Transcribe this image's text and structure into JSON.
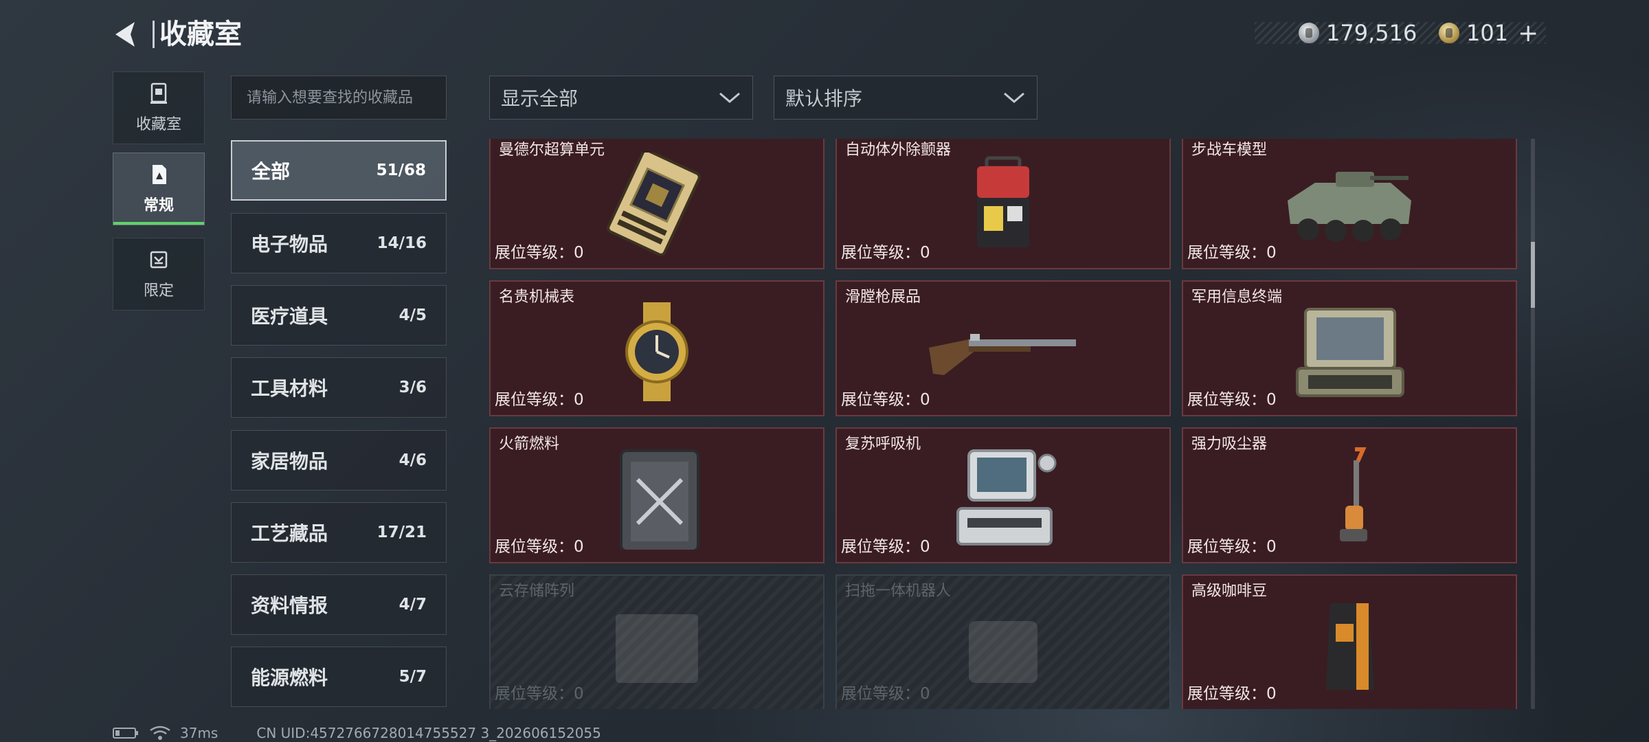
{
  "header": {
    "title": "收藏室"
  },
  "currency": {
    "silver": {
      "icon": "silver-coin-icon",
      "value": "179,516"
    },
    "gold": {
      "icon": "gold-coin-icon",
      "value": "101"
    },
    "plus": "+"
  },
  "sidebar": {
    "tabs": [
      {
        "label": "收藏室",
        "icon": "vault-icon"
      },
      {
        "label": "常规",
        "icon": "photo-frame-icon"
      },
      {
        "label": "限定",
        "icon": "limited-icon"
      }
    ],
    "active_index": 1
  },
  "search": {
    "placeholder": "请输入想要查找的收藏品"
  },
  "categories": [
    {
      "name": "全部",
      "count": "51/68"
    },
    {
      "name": "电子物品",
      "count": "14/16"
    },
    {
      "name": "医疗道具",
      "count": "4/5"
    },
    {
      "name": "工具材料",
      "count": "3/6"
    },
    {
      "name": "家居物品",
      "count": "4/6"
    },
    {
      "name": "工艺藏品",
      "count": "17/21"
    },
    {
      "name": "资料情报",
      "count": "4/7"
    },
    {
      "name": "能源燃料",
      "count": "5/7"
    }
  ],
  "filters": {
    "show": {
      "value": "显示全部"
    },
    "sort": {
      "value": "默认排序"
    }
  },
  "items": [
    {
      "name": "曼德尔超算单元",
      "level": "展位等级：0",
      "icon": "supercomputer-unit-icon",
      "locked": false
    },
    {
      "name": "自动体外除颤器",
      "level": "展位等级：0",
      "icon": "defibrillator-icon",
      "locked": false
    },
    {
      "name": "步战车模型",
      "level": "展位等级：0",
      "icon": "ifv-model-icon",
      "locked": false
    },
    {
      "name": "名贵机械表",
      "level": "展位等级：0",
      "icon": "luxury-watch-icon",
      "locked": false
    },
    {
      "name": "滑膛枪展品",
      "level": "展位等级：0",
      "icon": "musket-icon",
      "locked": false
    },
    {
      "name": "军用信息终端",
      "level": "展位等级：0",
      "icon": "military-terminal-icon",
      "locked": false
    },
    {
      "name": "火箭燃料",
      "level": "展位等级：0",
      "icon": "fuel-canister-icon",
      "locked": false
    },
    {
      "name": "复苏呼吸机",
      "level": "展位等级：0",
      "icon": "ventilator-icon",
      "locked": false
    },
    {
      "name": "强力吸尘器",
      "level": "展位等级：0",
      "icon": "vacuum-cleaner-icon",
      "locked": false
    },
    {
      "name": "云存储阵列",
      "level": "展位等级：0",
      "icon": "storage-array-icon",
      "locked": true
    },
    {
      "name": "扫拖一体机器人",
      "level": "展位等级：0",
      "icon": "robot-mop-icon",
      "locked": true
    },
    {
      "name": "高级咖啡豆",
      "level": "展位等级：0",
      "icon": "coffee-bag-icon",
      "locked": false
    }
  ],
  "status_bar": {
    "ping": "37ms",
    "uid": "CN UID:4572766728014755527 3_202606152055"
  },
  "colors": {
    "card_bg": "#3a1d22",
    "card_border": "#6a3a40",
    "active_green": "#5fd36b"
  }
}
